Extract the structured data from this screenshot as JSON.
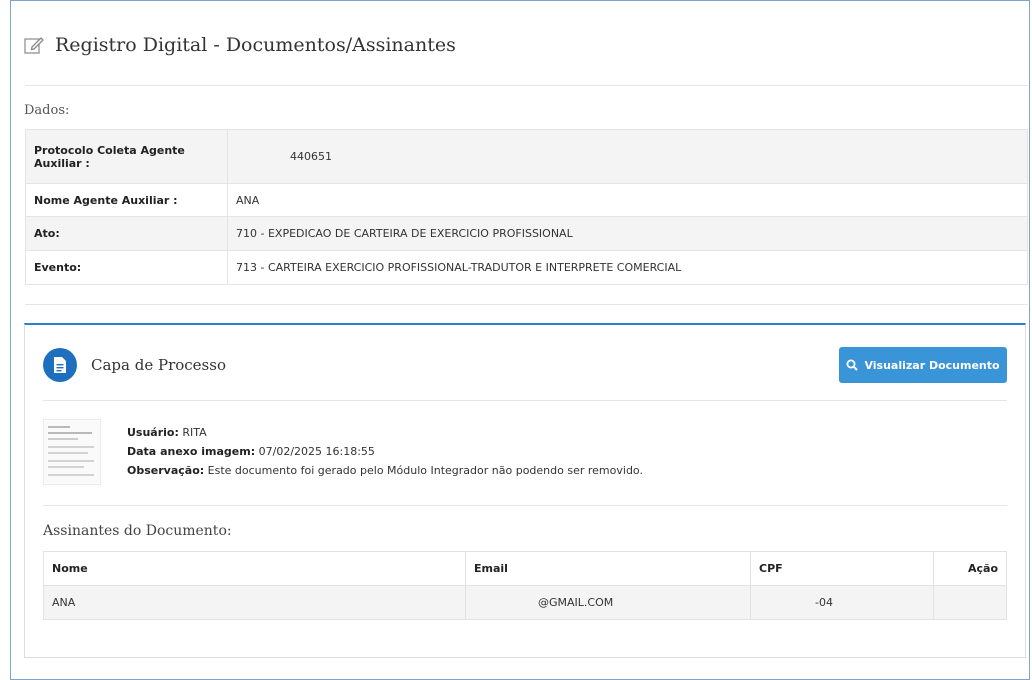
{
  "header": {
    "title": "Registro Digital - Documentos/Assinantes",
    "icon": "edit-icon"
  },
  "dados": {
    "label": "Dados:",
    "rows": [
      {
        "label": "Protocolo Coleta Agente Auxiliar :",
        "value": "440651"
      },
      {
        "label": "Nome Agente Auxiliar :",
        "value": "ANA"
      },
      {
        "label": "Ato:",
        "value": "710 - EXPEDICAO DE CARTEIRA DE EXERCICIO PROFISSIONAL"
      },
      {
        "label": "Evento:",
        "value": "713 - CARTEIRA EXERCICIO PROFISSIONAL-TRADUTOR E INTERPRETE COMERCIAL"
      }
    ]
  },
  "documento": {
    "title": "Capa de Processo",
    "icon": "document-icon",
    "view_button": "Visualizar Documento",
    "usuario_label": "Usuário:",
    "usuario": "RITA",
    "data_label": "Data anexo imagem:",
    "data": "07/02/2025 16:18:55",
    "obs_label": "Observação:",
    "obs": "Este documento foi gerado pelo Módulo Integrador não podendo ser removido."
  },
  "assinantes": {
    "title": "Assinantes do Documento:",
    "headers": [
      "Nome",
      "Email",
      "CPF",
      "Ação"
    ],
    "rows": [
      {
        "nome": "ANA",
        "email": "@GMAIL.COM",
        "cpf": "-04",
        "acao": ""
      }
    ]
  },
  "colors": {
    "accent": "#3a95d8",
    "panel_border": "#2f7fc9",
    "icon_circle": "#1f6fbf"
  }
}
